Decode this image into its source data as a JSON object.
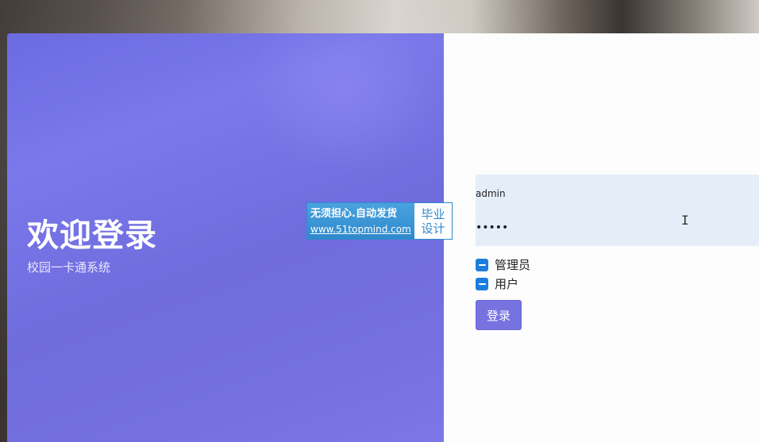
{
  "welcome": {
    "title": "欢迎登录",
    "subtitle": "校园一卡通系统"
  },
  "form": {
    "username_value": "admin",
    "password_value": "•••••",
    "roles": [
      {
        "label": "管理员",
        "checked": true
      },
      {
        "label": "用户",
        "checked": true
      }
    ],
    "login_label": "登录"
  },
  "watermark": {
    "slogan": "无须担心.自动发货",
    "url": "www.51topmind.com",
    "badge": "毕业设计"
  },
  "colors": {
    "panel_accent": "#7672e0",
    "checkbox": "#1d7ddc",
    "input_bg": "#e5edf9"
  }
}
